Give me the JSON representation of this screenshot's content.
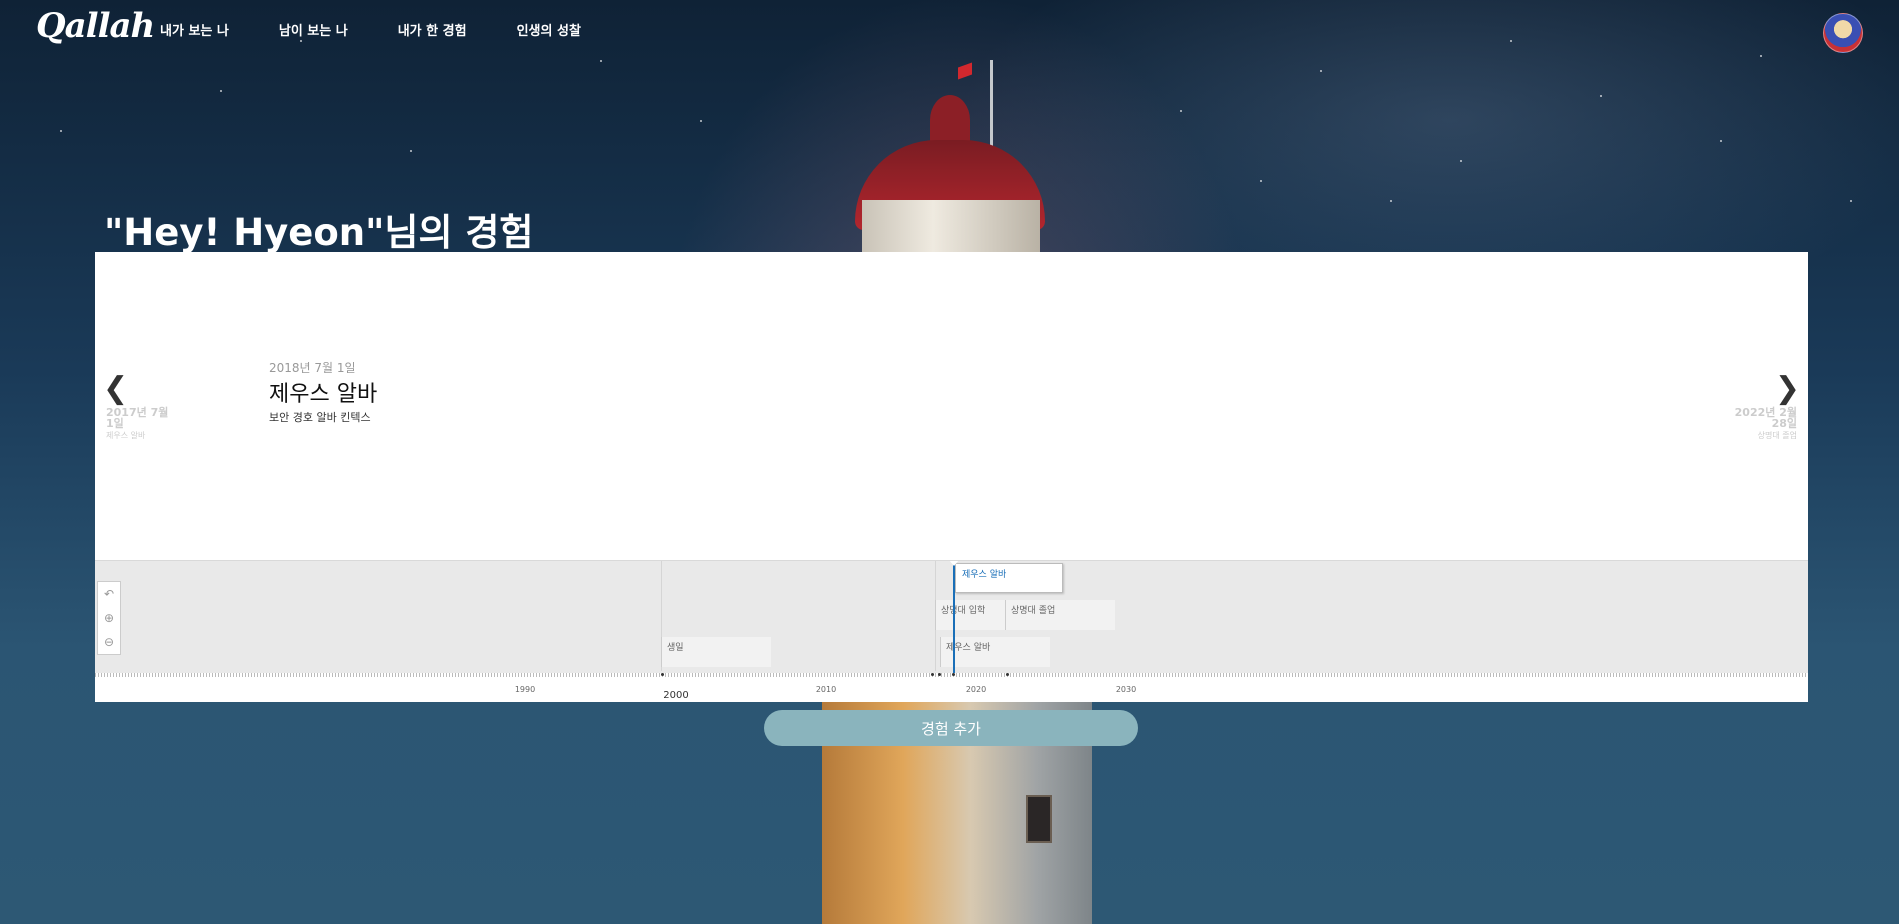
{
  "header": {
    "logo": "Qallah",
    "nav": [
      "내가 보는 나",
      "남이 보는 나",
      "내가 한 경험",
      "인생의 성찰"
    ]
  },
  "page": {
    "title": "\"Hey! Hyeon\"님의 경험"
  },
  "slide": {
    "date": "2018년 7월 1일",
    "headline": "제우스 알바",
    "text": "보안 경호 알바 킨텍스",
    "prev_date": "2017년 7월 1일",
    "prev_title": "제우스 알바",
    "next_date": "2022년 2월 28일",
    "next_title": "상명대 졸업"
  },
  "timeline": {
    "markers": [
      "제우스 알바",
      "상명대 입학",
      "상명대 졸업",
      "생일",
      "제우스 알바"
    ],
    "axis_labels": [
      "1990",
      "2000",
      "2010",
      "2020",
      "2030"
    ]
  },
  "actions": {
    "add_experience": "경험 추가"
  },
  "colors": {
    "accent": "#1a6fb8",
    "button": "#8ab4bd"
  }
}
